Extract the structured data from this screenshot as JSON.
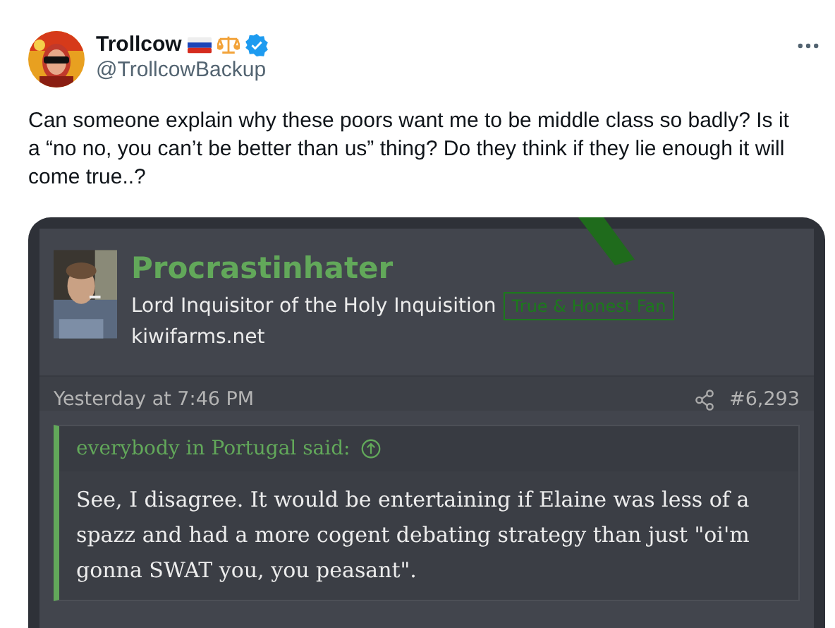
{
  "tweet": {
    "author": {
      "name": "Trollcow",
      "handle": "@TrollcowBackup",
      "verified": true
    },
    "text": "Can someone explain why these poors want me to be middle class so badly? Is it a “no no, you can’t be better than us” thing? Do they think if they lie enough it will come true..?",
    "media": {
      "post": {
        "username": "Procrastinhater",
        "user_title": "Lord Inquisitor of the Holy Inquisition",
        "badge": "True & Honest Fan",
        "site": "kiwifarms.net",
        "timestamp": "Yesterday at 7:46 PM",
        "post_number": "#6,293",
        "quote": {
          "attribution": "everybody in Portugal said:",
          "text": "See, I disagree. It would be entertaining if Elaine was less of a spazz and had a more cogent debating strategy than just \"oi'm gonna SWAT you, you peasant\"."
        }
      }
    }
  }
}
